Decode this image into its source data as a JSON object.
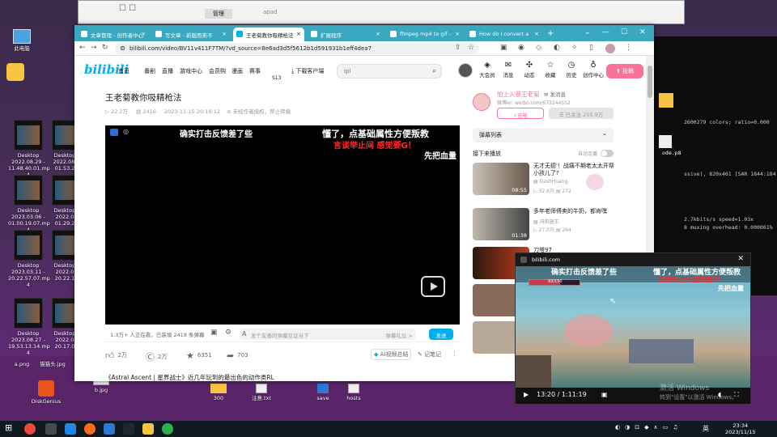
{
  "desktop": {
    "icons": [
      {
        "label": "此电脑"
      },
      {
        "label": "Desktop\n2022.08.29 -\n11.48.40.01.mp\n4"
      },
      {
        "label": "Desktop\n2022.08.\n01.53.2"
      },
      {
        "label": "Desktop\n2023.03.06 -\n01.00.19.07.mp\n4"
      },
      {
        "label": "Desktop\n2022.0\n01.29.2"
      },
      {
        "label": "Desktop\n2023.03.11 -\n20.22.57.07.mp\n4"
      },
      {
        "label": "Desktop\n2022.0\n20.22.1"
      },
      {
        "label": "Desktop\n2023.08.27 -\n19.53.13.14.mp\n4"
      },
      {
        "label": "Desktop\n2022.0\n20.17.0"
      },
      {
        "label": "a.png"
      },
      {
        "label": "猫猫头.jpg"
      },
      {
        "label": "DiskGenius"
      },
      {
        "label": "b.jpg"
      },
      {
        "label": "300"
      },
      {
        "label": "注意.txt"
      },
      {
        "label": "save"
      },
      {
        "label": "hosts"
      }
    ],
    "back_window": {
      "tab1": "管理",
      "tab2": "apad"
    }
  },
  "terminal": {
    "lines": [
      "2600279 colors; ratio=0.000",
      "ssive), 820x461 [SAR 1844:184",
      "2.7kbits/s speed=1.03x",
      "8 muxing overhead: 0.000061%"
    ],
    "file_label": "ode.p8"
  },
  "browser": {
    "tabs": [
      {
        "label": "文章管理 - 创作者中心",
        "active": false
      },
      {
        "label": "写文章 - 新版而来不",
        "active": false
      },
      {
        "label": "王老菊教你吸精枪法",
        "active": true
      },
      {
        "label": "扩展程序",
        "active": false
      },
      {
        "label": "ffmpeg mp4 to gif -",
        "active": false
      },
      {
        "label": "How do I convert a",
        "active": false
      }
    ],
    "new_tab": "+",
    "url": "bilibili.com/video/BV11v411F7TM/?vd_source=8e6ad3d5f5612b1d591931b1eff4dea7"
  },
  "bili": {
    "logo": "bilibili",
    "nav": [
      "首页",
      "番剧",
      "直播",
      "游戏中心",
      "会员购",
      "漫画",
      "赛事"
    ],
    "nav_extra": "S13",
    "download": "下载客户端",
    "search_value": "ipl",
    "header_icons": [
      {
        "label": "大会员",
        "icon": "crown-icon",
        "glyph": "◈"
      },
      {
        "label": "消息",
        "icon": "message-icon",
        "glyph": "✉"
      },
      {
        "label": "动态",
        "icon": "feed-icon",
        "glyph": "✣"
      },
      {
        "label": "收藏",
        "icon": "star-icon",
        "glyph": "☆"
      },
      {
        "label": "历史",
        "icon": "clock-icon",
        "glyph": "◷"
      },
      {
        "label": "创作中心",
        "icon": "bulb-icon",
        "glyph": "♁"
      }
    ],
    "upload": "投稿"
  },
  "video": {
    "title": "王老菊教你吸精枪法",
    "views": "22.2万",
    "danmaku_count": "2416",
    "date": "2023-11-15 20:16:12",
    "notice": "未经作者授权，禁止转载",
    "danmaku": [
      "确实打击反馈差了些",
      "懂了，点基础属性方便叛教",
      "言谈举止间  感觉要G！",
      "先把血量"
    ],
    "watching": "1.3万+ 人正在看，已装填 2418 条弹幕",
    "dm_placeholder": "发个友善的弹幕见证当下",
    "dm_etiquette": "弹幕礼仪 >",
    "send": "发送",
    "likes": "2万",
    "coins": "2万",
    "favorites": "6351",
    "shares": "703",
    "ai_summary": "AI视频总结",
    "notes": "记笔记",
    "description": "《Astral Ascent | 星界战士》近几年玩到的最出色的动作类RL"
  },
  "uploader": {
    "name": "怕上火暴王老菊",
    "message": "发消息",
    "bio": "微博er: weibo.com/673244552",
    "charge": "充电",
    "followed": "已关注 255.9万"
  },
  "sidebar": {
    "danmaku_list": "弹幕列表",
    "next_label": "接下来播放",
    "autoplay": "自动连播",
    "recs": [
      {
        "title": "无才无德'！战痛不期老太太开帮小孩儿了?",
        "up": "DashHuang",
        "views": "32.6万",
        "danmaku": "272",
        "duration": "08:55"
      },
      {
        "title": "多年老师傅卖的牛奶，都肯嘿",
        "up": "冯阳施王",
        "views": "27.0万",
        "danmaku": "264",
        "duration": "01:38"
      },
      {
        "title": "刀塔97",
        "up": "",
        "views": "",
        "danmaku": "",
        "duration": ""
      }
    ]
  },
  "mini_player": {
    "site": "bilibili.com",
    "danmaku": [
      "确实打击反馈差了些",
      "懂了，点基础属性方便叛教",
      "言谈举止间  感觉要G！",
      "先把血量"
    ],
    "time": "13:20 / 1:11:19",
    "hud_score": "93/150"
  },
  "watermark": {
    "line1": "激活 Windows",
    "line2": "转到\"设置\"以激活 Windows。"
  },
  "taskbar": {
    "ime": "英",
    "time": "23:34",
    "date": "2023/11/15"
  }
}
